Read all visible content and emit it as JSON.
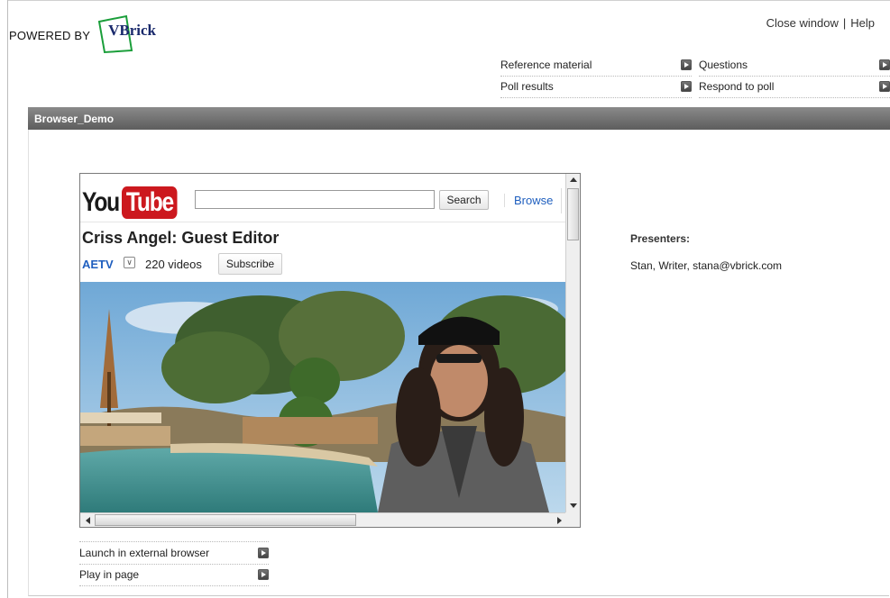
{
  "header": {
    "powered_by": "POWERED BY",
    "logo_text": "VBrick",
    "close_window": "Close window",
    "separator": "|",
    "help": "Help"
  },
  "panel_links": [
    {
      "label": "Reference material"
    },
    {
      "label": "Questions"
    },
    {
      "label": "Poll results"
    },
    {
      "label": "Respond to poll"
    }
  ],
  "title_bar": "Browser_Demo",
  "youtube": {
    "logo_you": "You",
    "logo_tube": "Tube",
    "search_value": "",
    "search_button": "Search",
    "browse": "Browse",
    "video_title": "Criss Angel: Guest Editor",
    "channel": "AETV",
    "video_count": "220 videos",
    "subscribe": "Subscribe"
  },
  "launch_links": [
    {
      "label": "Launch in external browser"
    },
    {
      "label": "Play in page"
    }
  ],
  "presenters": {
    "heading": "Presenters:",
    "value": "Stan, Writer, stana@vbrick.com"
  },
  "colors": {
    "youtube_red": "#cc181e",
    "link_blue": "#1f5fbf",
    "titlebar_gray": "#6f6f6f",
    "vbrick_green": "#1a9e3a"
  }
}
